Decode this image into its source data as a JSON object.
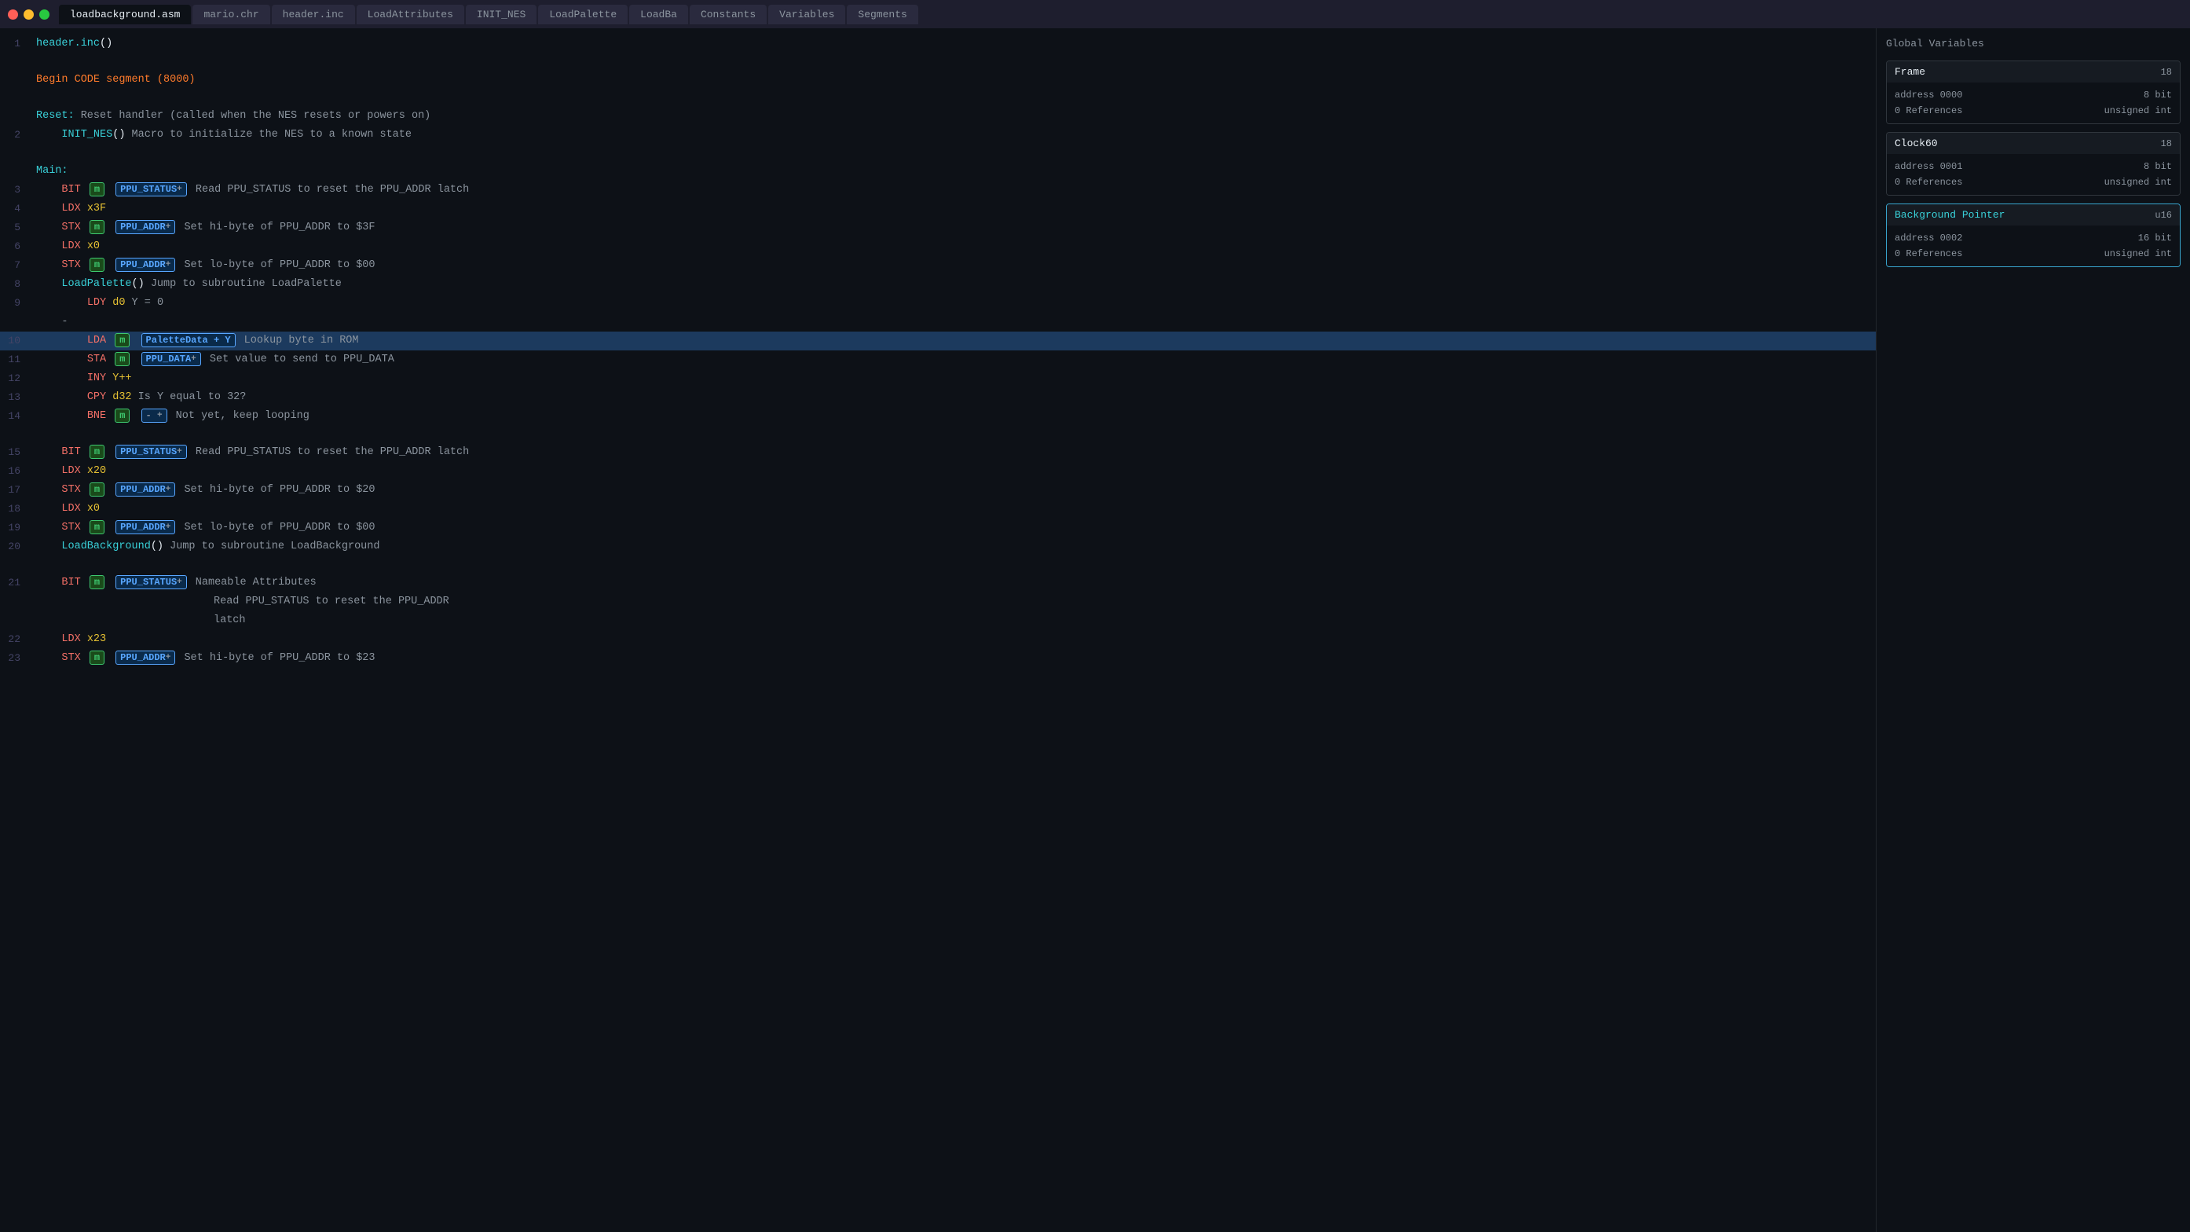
{
  "titleBar": {
    "trafficLights": [
      "red",
      "yellow",
      "green"
    ],
    "tabs": [
      {
        "label": "loadbackground.asm",
        "active": true
      },
      {
        "label": "mario.chr",
        "active": false
      },
      {
        "label": "header.inc",
        "active": false
      },
      {
        "label": "LoadAttributes",
        "active": false
      },
      {
        "label": "INIT_NES",
        "active": false
      },
      {
        "label": "LoadPalette",
        "active": false
      },
      {
        "label": "LoadBa",
        "active": false
      },
      {
        "label": "Constants",
        "active": false
      },
      {
        "label": "Variables",
        "active": false
      },
      {
        "label": "Segments",
        "active": false
      }
    ]
  },
  "sidebar": {
    "title": "Global Variables",
    "variables": [
      {
        "name": "Frame",
        "size": "18",
        "address": "0000",
        "bits": "8 bit",
        "refs": "0 References",
        "type": "unsigned int",
        "highlighted": false
      },
      {
        "name": "Clock60",
        "size": "18",
        "address": "0001",
        "bits": "8 bit",
        "refs": "0 References",
        "type": "unsigned int",
        "highlighted": false
      },
      {
        "name": "Background Pointer",
        "size": "u16",
        "address": "0002",
        "bits": "16 bit",
        "refs": "0 References",
        "type": "unsigned int",
        "highlighted": true
      }
    ]
  },
  "codeLines": [
    {
      "num": "1",
      "content": "header_inc_call",
      "type": "special"
    },
    {
      "num": "",
      "content": ""
    },
    {
      "num": "",
      "content": "begin_code_segment"
    },
    {
      "num": "",
      "content": ""
    },
    {
      "num": "",
      "content": "reset_comment"
    },
    {
      "num": "2",
      "content": "init_nes_call"
    },
    {
      "num": "",
      "content": ""
    },
    {
      "num": "",
      "content": "main_label"
    },
    {
      "num": "3",
      "content": "bit_ppu_status_1"
    },
    {
      "num": "4",
      "content": "ldx_3f"
    },
    {
      "num": "5",
      "content": "stx_ppu_addr_1"
    },
    {
      "num": "6",
      "content": "ldx_0"
    },
    {
      "num": "7",
      "content": "stx_ppu_addr_2"
    },
    {
      "num": "8",
      "content": "load_palette_call"
    },
    {
      "num": "9",
      "content": "ldy_d0"
    },
    {
      "num": "",
      "content": "dash"
    },
    {
      "num": "10",
      "content": "lda_palette_data",
      "highlighted": true
    },
    {
      "num": "11",
      "content": "sta_ppu_data"
    },
    {
      "num": "12",
      "content": "iny"
    },
    {
      "num": "13",
      "content": "cpy_d32"
    },
    {
      "num": "14",
      "content": "bne"
    },
    {
      "num": "",
      "content": ""
    },
    {
      "num": "15",
      "content": "bit_ppu_status_2"
    },
    {
      "num": "16",
      "content": "ldx_20"
    },
    {
      "num": "17",
      "content": "stx_ppu_addr_3"
    },
    {
      "num": "18",
      "content": "ldx_0_2"
    },
    {
      "num": "19",
      "content": "stx_ppu_addr_4"
    },
    {
      "num": "20",
      "content": "load_background_call"
    },
    {
      "num": "",
      "content": ""
    },
    {
      "num": "21",
      "content": "bit_ppu_status_3"
    },
    {
      "num": "22",
      "content": "ldx_23"
    },
    {
      "num": "23",
      "content": "stx_ppu_addr_5"
    }
  ]
}
